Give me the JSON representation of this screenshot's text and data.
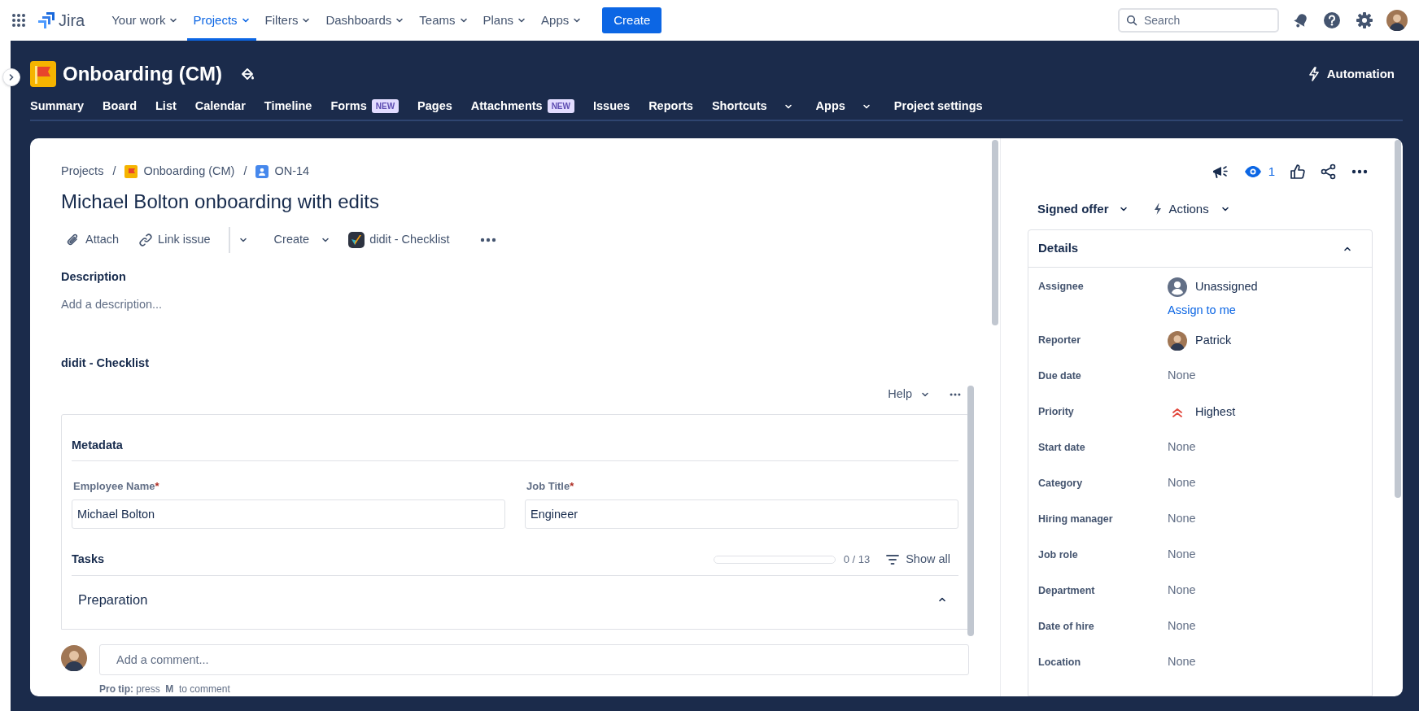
{
  "top_nav": {
    "app_name": "Jira",
    "items": [
      {
        "label": "Your work",
        "selected": false
      },
      {
        "label": "Projects",
        "selected": true
      },
      {
        "label": "Filters",
        "selected": false
      },
      {
        "label": "Dashboards",
        "selected": false
      },
      {
        "label": "Teams",
        "selected": false
      },
      {
        "label": "Plans",
        "selected": false
      },
      {
        "label": "Apps",
        "selected": false
      }
    ],
    "create_button": "Create",
    "search": {
      "placeholder": "Search"
    }
  },
  "project": {
    "title": "Onboarding (CM)",
    "automation": "Automation",
    "tabs": [
      {
        "label": "Summary",
        "dropdown": false
      },
      {
        "label": "Board",
        "dropdown": false
      },
      {
        "label": "List",
        "dropdown": false
      },
      {
        "label": "Calendar",
        "dropdown": false
      },
      {
        "label": "Timeline",
        "dropdown": false
      },
      {
        "label": "Forms",
        "badge": "NEW",
        "dropdown": false
      },
      {
        "label": "Pages",
        "dropdown": false
      },
      {
        "label": "Attachments",
        "badge": "NEW",
        "dropdown": false
      },
      {
        "label": "Issues",
        "dropdown": false
      },
      {
        "label": "Reports",
        "dropdown": false
      },
      {
        "label": "Shortcuts",
        "dropdown": true
      },
      {
        "label": "Apps",
        "dropdown": true
      },
      {
        "label": "Project settings",
        "dropdown": false
      }
    ]
  },
  "issue": {
    "breadcrumbs": [
      {
        "kind": "plain",
        "label": "Projects"
      },
      {
        "kind": "separator",
        "label": "/"
      },
      {
        "kind": "project",
        "label": "Onboarding (CM)"
      },
      {
        "kind": "separator",
        "label": "/"
      },
      {
        "kind": "issue",
        "label": "ON-14"
      }
    ],
    "title": "Michael Bolton onboarding with edits",
    "toolbar": [
      {
        "kind": "attach",
        "label": "Attach"
      },
      {
        "kind": "link",
        "label": "Link issue"
      },
      {
        "kind": "split"
      },
      {
        "kind": "create",
        "label": "Create"
      },
      {
        "kind": "app",
        "label": "didit - Checklist"
      },
      {
        "kind": "more"
      }
    ],
    "description": {
      "heading": "Description",
      "placeholder": "Add a description..."
    }
  },
  "checklist": {
    "heading": "didit - Checklist",
    "help": "Help",
    "section": "Metadata",
    "fields": [
      {
        "label": "Employee Name",
        "mark": "*",
        "value": "Michael Bolton"
      },
      {
        "label": "Job Title",
        "mark": "*",
        "value": "Engineer"
      }
    ],
    "tasks": {
      "heading": "Tasks",
      "level": 0,
      "count": "0 / 13",
      "filter": "Show all"
    },
    "groups": [
      {
        "label": "Preparation",
        "expanded": true
      }
    ]
  },
  "comment": {
    "placeholder": "Add a comment...",
    "tip": "**Pro tip:** press  **M**  to comment"
  },
  "side": {
    "watchers": "1",
    "status": "Signed offer",
    "actions": "Actions",
    "details": {
      "heading": "Details",
      "expanded": true,
      "fields": [
        {
          "label": "Assignee",
          "kind": "unassigned",
          "value": "Unassigned",
          "link": "Assign to me"
        },
        {
          "label": "Reporter",
          "kind": "user",
          "value": "Patrick"
        },
        {
          "label": "Due date",
          "kind": "none",
          "value": "None"
        },
        {
          "label": "Priority",
          "kind": "priority",
          "value": "Highest"
        },
        {
          "label": "Start date",
          "kind": "none",
          "value": "None"
        },
        {
          "label": "Category",
          "kind": "none",
          "value": "None"
        },
        {
          "label": "Hiring manager",
          "kind": "none",
          "value": "None"
        },
        {
          "label": "Job role",
          "kind": "none",
          "value": "None"
        },
        {
          "label": "Department",
          "kind": "none",
          "value": "None"
        },
        {
          "label": "Date of hire",
          "kind": "none",
          "value": "None"
        },
        {
          "label": "Location",
          "kind": "none",
          "value": "None"
        }
      ]
    }
  }
}
